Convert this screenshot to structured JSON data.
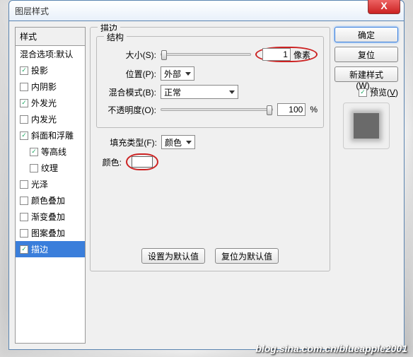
{
  "window": {
    "title": "图层样式",
    "close": "X"
  },
  "left": {
    "header": "样式",
    "blend": "混合选项:默认",
    "items": [
      {
        "label": "投影",
        "checked": true
      },
      {
        "label": "内阴影",
        "checked": false
      },
      {
        "label": "外发光",
        "checked": true
      },
      {
        "label": "内发光",
        "checked": false
      },
      {
        "label": "斜面和浮雕",
        "checked": true
      },
      {
        "label": "等高线",
        "checked": true,
        "indent": true
      },
      {
        "label": "纹理",
        "checked": false,
        "indent": true
      },
      {
        "label": "光泽",
        "checked": false
      },
      {
        "label": "颜色叠加",
        "checked": false
      },
      {
        "label": "渐变叠加",
        "checked": false
      },
      {
        "label": "图案叠加",
        "checked": false
      },
      {
        "label": "描边",
        "checked": true,
        "selected": true
      }
    ]
  },
  "mid": {
    "title": "描边",
    "group1": "结构",
    "size_label": "大小(S):",
    "size_value": "1",
    "size_unit": "像素",
    "pos_label": "位置(P):",
    "pos_value": "外部",
    "blend_label": "混合模式(B):",
    "blend_value": "正常",
    "opacity_label": "不透明度(O):",
    "opacity_value": "100",
    "opacity_unit": "%",
    "fill_label": "填充类型(F):",
    "fill_value": "颜色",
    "color_label": "颜色:",
    "default_btn": "设置为默认值",
    "reset_btn": "复位为默认值"
  },
  "right": {
    "ok": "确定",
    "cancel": "复位",
    "newstyle": "新建样式(W)...",
    "preview_label": "预览(V)",
    "preview_checked": true
  },
  "watermark": "blog.sina.com.cn/blueapple2001"
}
